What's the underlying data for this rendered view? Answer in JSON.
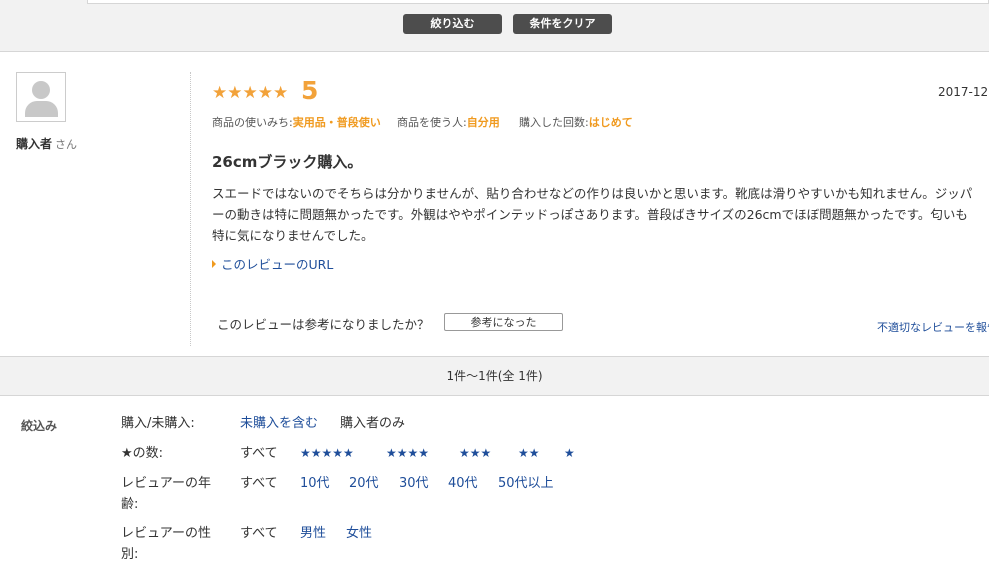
{
  "toolbar": {
    "filter_button": "絞り込む",
    "clear_button": "条件をクリア"
  },
  "review": {
    "reviewer_name": "購入者",
    "reviewer_suffix": "さん",
    "stars": "★★★★★",
    "rating": "5",
    "date": "2017-12",
    "meta": [
      {
        "label": "商品の使いみち:",
        "value": "実用品・普段使い"
      },
      {
        "label": "商品を使う人:",
        "value": "自分用"
      },
      {
        "label": "購入した回数:",
        "value": "はじめて"
      }
    ],
    "title": "26cmブラック購入。",
    "body_lines": [
      "スエードではないのでそちらは分かりませんが、貼り合わせなどの作りは良いかと思います。靴底は滑りやすいかも知れません。ジッパ",
      "ーの動きは特に問題無かったです。外観はややポインテッドっぽさあります。普段ばきサイズの26cmでほぼ問題無かったです。匂いも",
      "特に気になりませんでした。"
    ],
    "url_link": "このレビューのURL",
    "helpful_question": "このレビューは参考になりましたか？",
    "helpful_button": "参考になった",
    "report_link": "不適切なレビューを報告"
  },
  "pagination": {
    "text": "1件〜1件(全 1件)"
  },
  "filters": {
    "heading": "絞込み",
    "purchase": {
      "label": "購入/未購入:",
      "options": [
        "未購入を含む",
        "購入者のみ"
      ]
    },
    "stars": {
      "label": "★の数:",
      "options": [
        "すべて",
        "★★★★★",
        "★★★★",
        "★★★",
        "★★",
        "★"
      ]
    },
    "age": {
      "label": "レビュアーの年齢:",
      "options": [
        "すべて",
        "10代",
        "20代",
        "30代",
        "40代",
        "50代以上"
      ]
    },
    "gender": {
      "label": "レビュアーの性別:",
      "options": [
        "すべて",
        "男性",
        "女性"
      ]
    }
  },
  "colors": {
    "accent_orange": "#f2a23a",
    "link_blue": "#1f4e9a",
    "dark_button": "#4d4d4d"
  }
}
